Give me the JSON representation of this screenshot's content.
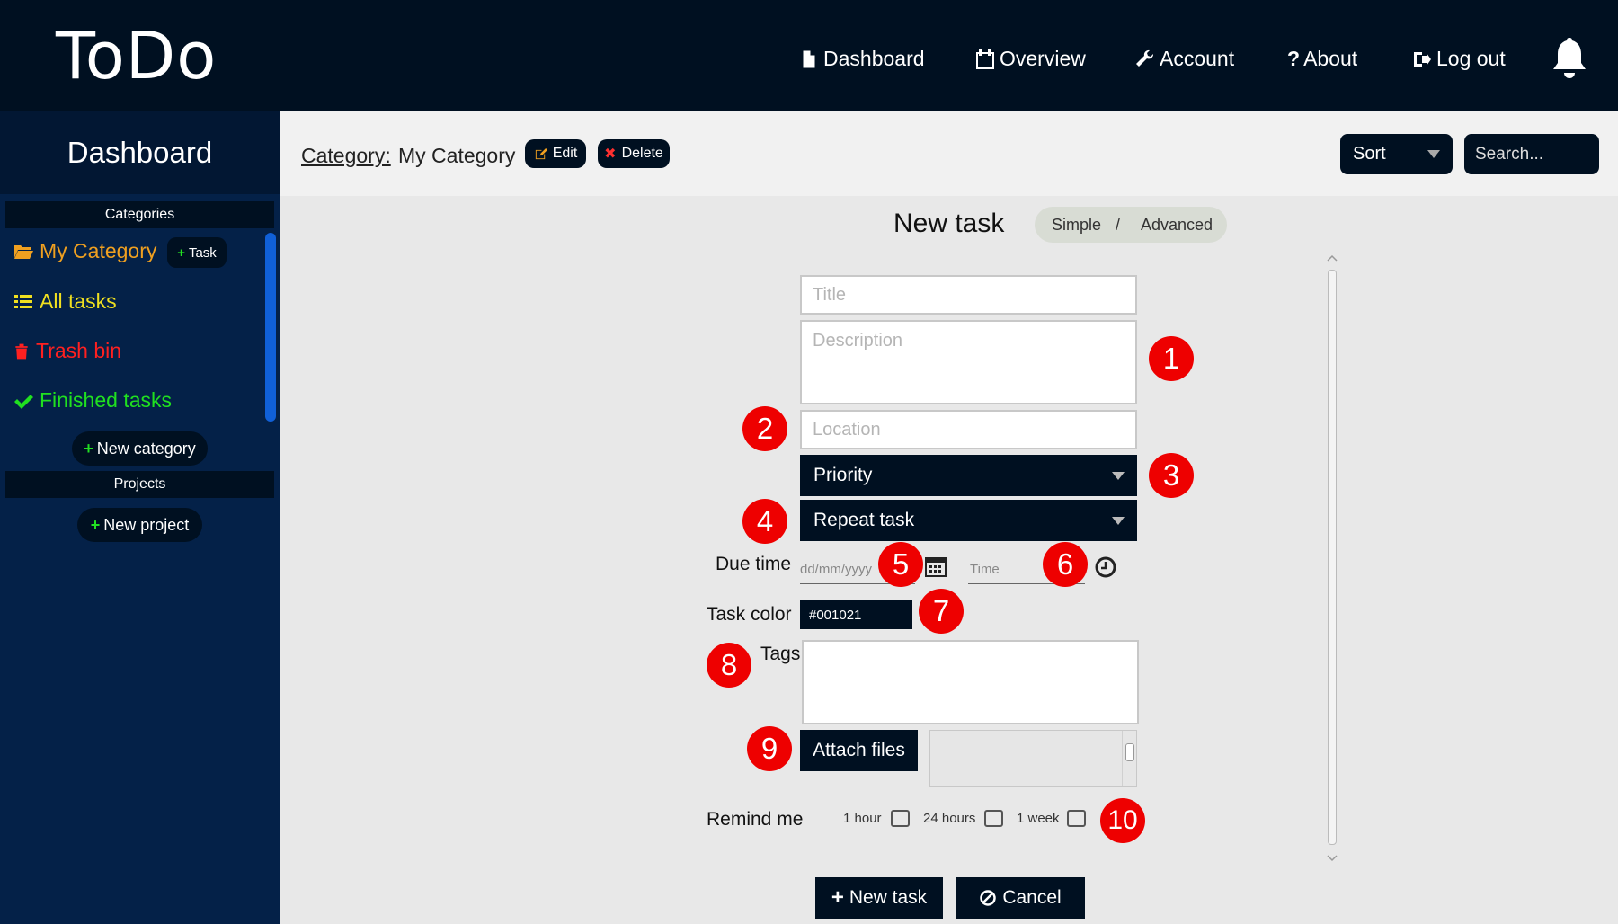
{
  "app": {
    "title": "ToDo"
  },
  "nav": {
    "dashboard": "Dashboard",
    "overview": "Overview",
    "account": "Account",
    "about": "About",
    "logout": "Log out"
  },
  "sidebar": {
    "title": "Dashboard",
    "categories_header": "Categories",
    "my_category": "My Category",
    "task_button": "Task",
    "all_tasks": "All tasks",
    "trash_bin": "Trash bin",
    "finished_tasks": "Finished tasks",
    "new_category": "New category",
    "projects_header": "Projects",
    "new_project": "New project"
  },
  "category_bar": {
    "label": "Category:",
    "name": "My Category",
    "edit": "Edit",
    "delete": "Delete",
    "sort": "Sort",
    "search_placeholder": "Search..."
  },
  "form": {
    "title": "New task",
    "mode_simple": "Simple",
    "mode_separator": "/",
    "mode_advanced": "Advanced",
    "title_placeholder": "Title",
    "description_placeholder": "Description",
    "location_placeholder": "Location",
    "priority": "Priority",
    "repeat": "Repeat task",
    "due_label": "Due time",
    "date_placeholder": "dd/mm/yyyy",
    "time_placeholder": "Time",
    "color_label": "Task color",
    "color_value": "#001021",
    "tags_label": "Tags",
    "attach": "Attach files",
    "remind_label": "Remind me",
    "remind_1h": "1 hour",
    "remind_24h": "24 hours",
    "remind_1w": "1 week",
    "submit": "New task",
    "cancel": "Cancel"
  },
  "badges": [
    "1",
    "2",
    "3",
    "4",
    "5",
    "6",
    "7",
    "8",
    "9",
    "10"
  ],
  "colors": {
    "navy": "#001021",
    "sidebar": "#042148",
    "category_orange": "#f0a020",
    "all_tasks_yellow": "#f0e020",
    "trash_red": "#ff2020",
    "finished_green": "#20e020",
    "badge_red": "#ee0000"
  }
}
